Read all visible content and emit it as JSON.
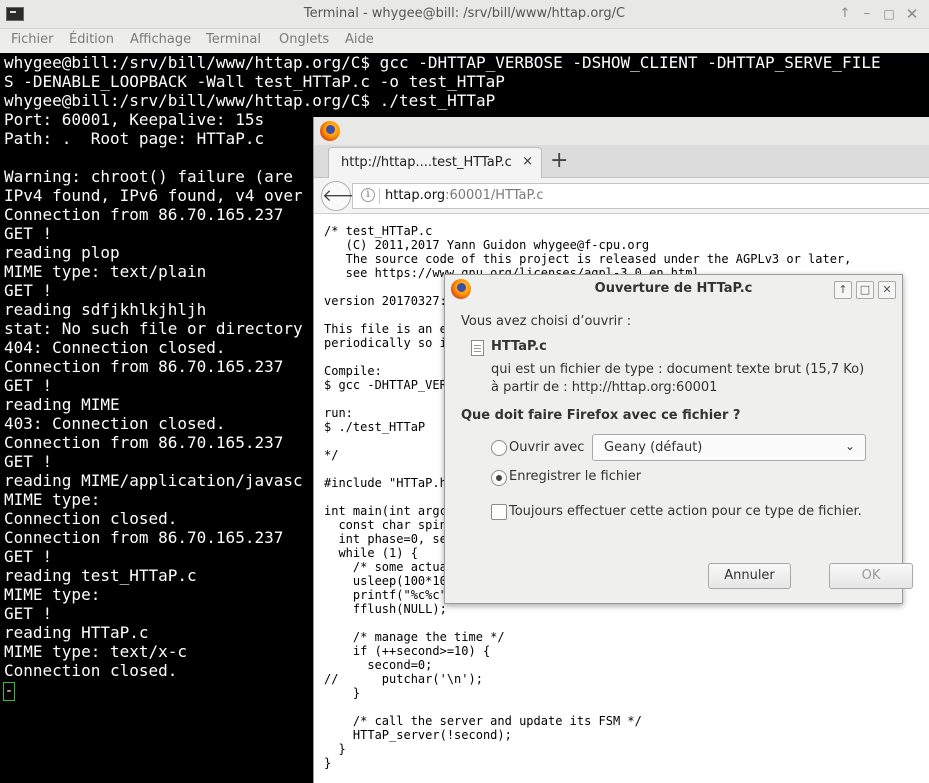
{
  "terminal": {
    "title": "Terminal - whygee@bill: /srv/bill/www/httap.org/C",
    "menu": [
      "Fichier",
      "Édition",
      "Affichage",
      "Terminal",
      "Onglets",
      "Aide"
    ],
    "lines": [
      "whygee@bill:/srv/bill/www/httap.org/C$ gcc -DHTTAP_VERBOSE -DSHOW_CLIENT -DHTTAP_SERVE_FILE",
      "S -DENABLE_LOOPBACK -Wall test_HTTaP.c -o test_HTTaP",
      "whygee@bill:/srv/bill/www/httap.org/C$ ./test_HTTaP",
      "Port: 60001, Keepalive: 15s",
      "Path: .  Root page: HTTaP.c",
      "",
      "Warning: chroot() failure (are",
      "IPv4 found, IPv6 found, v4 over",
      "Connection from 86.70.165.237",
      "GET !",
      "reading plop",
      "MIME type: text/plain",
      "GET !",
      "reading sdfjkhlkjhljh",
      "stat: No such file or directory",
      "404: Connection closed.",
      "Connection from 86.70.165.237",
      "GET !",
      "reading MIME",
      "403: Connection closed.",
      "Connection from 86.70.165.237",
      "GET !",
      "reading MIME/application/javasc",
      "MIME type:",
      "Connection closed.",
      "Connection from 86.70.165.237",
      "GET !",
      "reading test_HTTaP.c",
      "MIME type:",
      "GET !",
      "reading HTTaP.c",
      "MIME type: text/x-c",
      "Connection closed."
    ],
    "cursor": "-"
  },
  "firefox": {
    "tab_title": "http://httap....test_HTTaP.c",
    "tab_close": "×",
    "new_tab": "+",
    "url_host": "httap.org",
    "url_rest": ":60001/HTTaP.c",
    "content_lines": [
      "/* test_HTTaP.c",
      "   (C) 2011,2017 Yann Guidon whygee@f-cpu.org",
      "   The source code of this project is released under the AGPLv3 or later,",
      "   see https://www.gnu.org/licenses/agpl-3.0.en.html",
      "",
      "version 20170327:",
      "",
      "This file is an ex",
      "periodically so it",
      "",
      "Compile:",
      "$ gcc -DHTTAP_VERB",
      "",
      "run:",
      "$ ./test_HTTaP",
      "",
      "*/",
      "",
      "#include \"HTTaP.h",
      "",
      "int main(int argc",
      "  const char spinn",
      "  int phase=0, sec",
      "  while (1) {",
      "    /* some actua",
      "    usleep(100*100",
      "    printf(\"%c%c\"",
      "    fflush(NULL);",
      "",
      "    /* manage the time */",
      "    if (++second>=10) {",
      "      second=0;",
      "//      putchar('\\n');",
      "    }",
      "",
      "    /* call the server and update its FSM */",
      "    HTTaP_server(!second);",
      "  }",
      "}"
    ]
  },
  "dialog": {
    "title": "Ouverture de HTTaP.c",
    "intro": "Vous avez choisi d’ouvrir :",
    "filename": "HTTaP.c",
    "filetype": "qui est un fichier de type : document texte brut (15,7 Ko)",
    "source": "à partir de : http://httap.org:60001",
    "question": "Que doit faire Firefox avec ce fichier ?",
    "open_with_label": "Ouvrir avec",
    "open_with_app": "Geany (défaut)",
    "save_label": "Enregistrer le fichier",
    "always_label": "Toujours effectuer cette action pour ce type de fichier.",
    "open_with_selected": false,
    "save_selected": true,
    "always_checked": false,
    "cancel_label": "Annuler",
    "ok_label": "OK"
  }
}
